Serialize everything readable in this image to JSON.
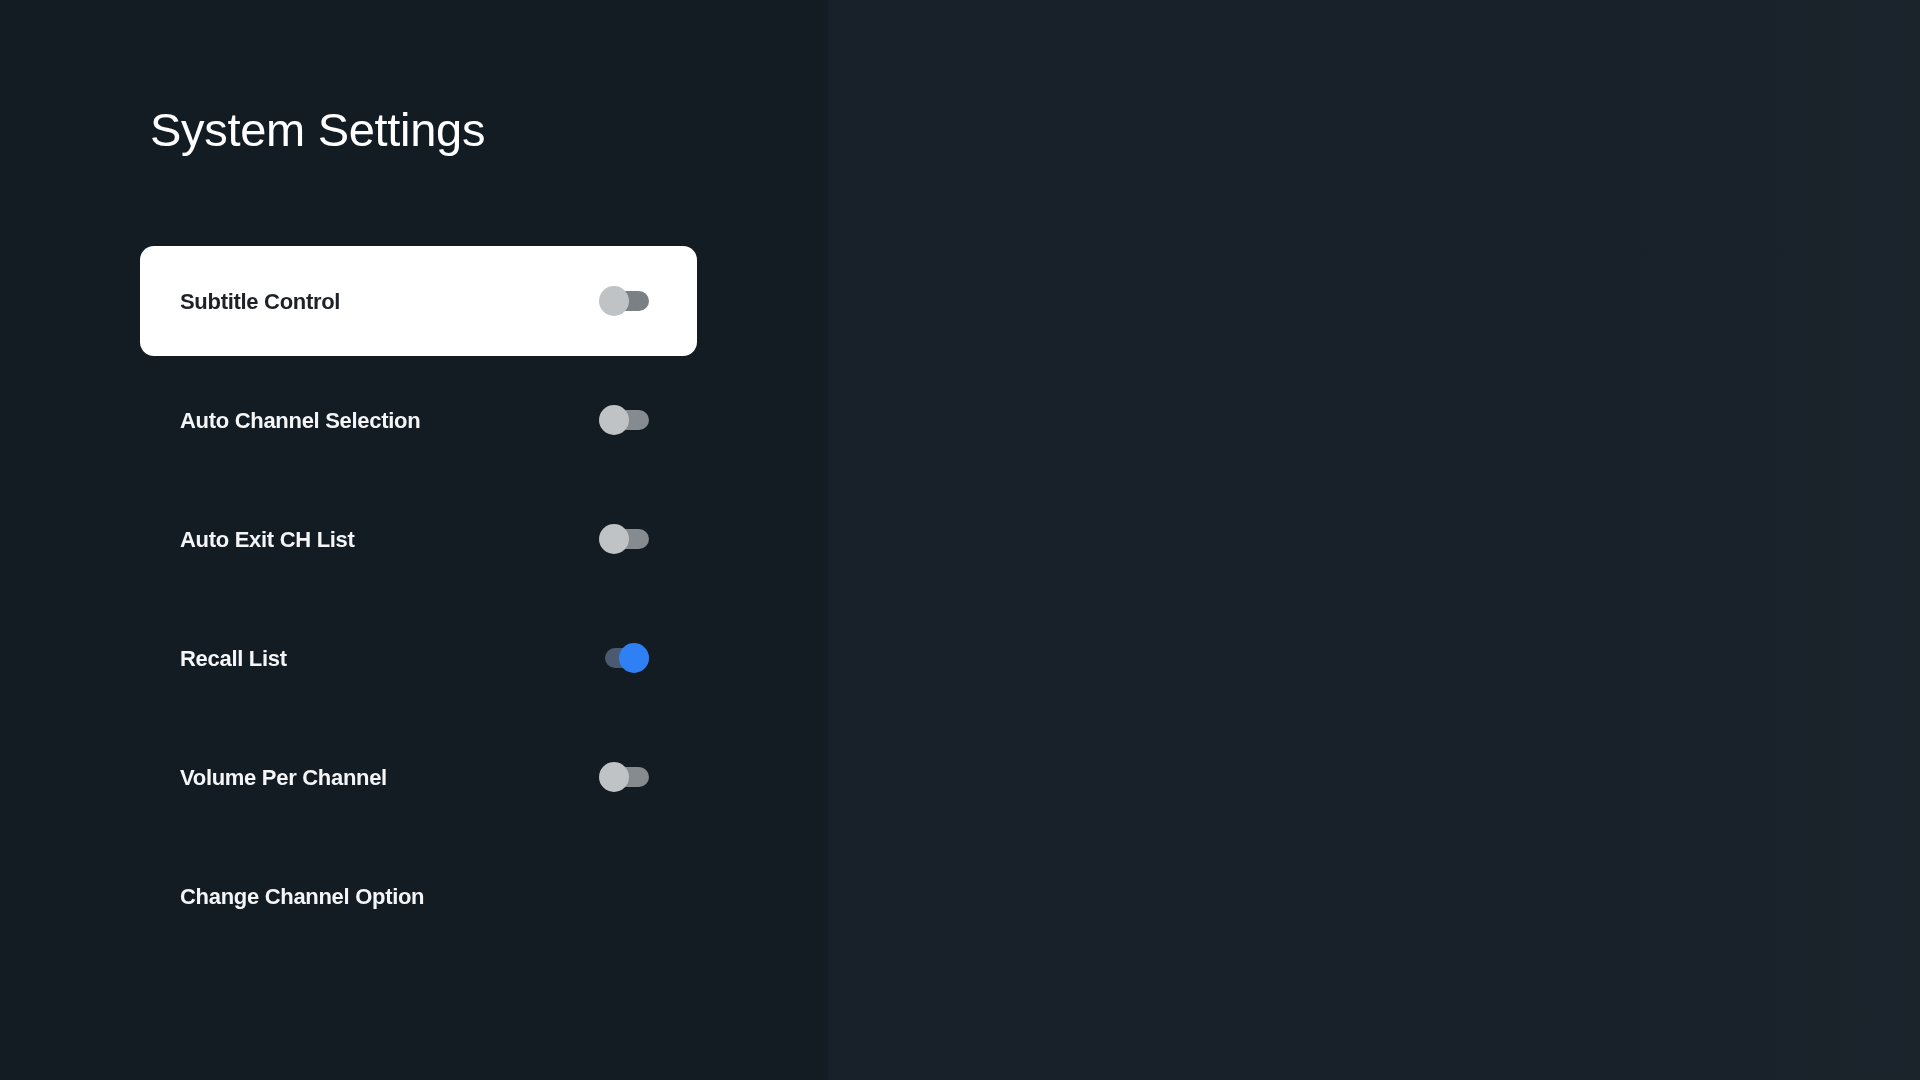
{
  "title": "System Settings",
  "settings": [
    {
      "label": "Subtitle Control",
      "kind": "toggle",
      "selected": true,
      "on": false
    },
    {
      "label": "Auto Channel Selection",
      "kind": "toggle",
      "selected": false,
      "on": false
    },
    {
      "label": "Auto Exit CH List",
      "kind": "toggle",
      "selected": false,
      "on": false
    },
    {
      "label": "Recall List",
      "kind": "toggle",
      "selected": false,
      "on": true
    },
    {
      "label": "Volume Per Channel",
      "kind": "toggle",
      "selected": false,
      "on": false
    },
    {
      "label": "Change Channel Option",
      "kind": "option",
      "selected": false
    }
  ]
}
